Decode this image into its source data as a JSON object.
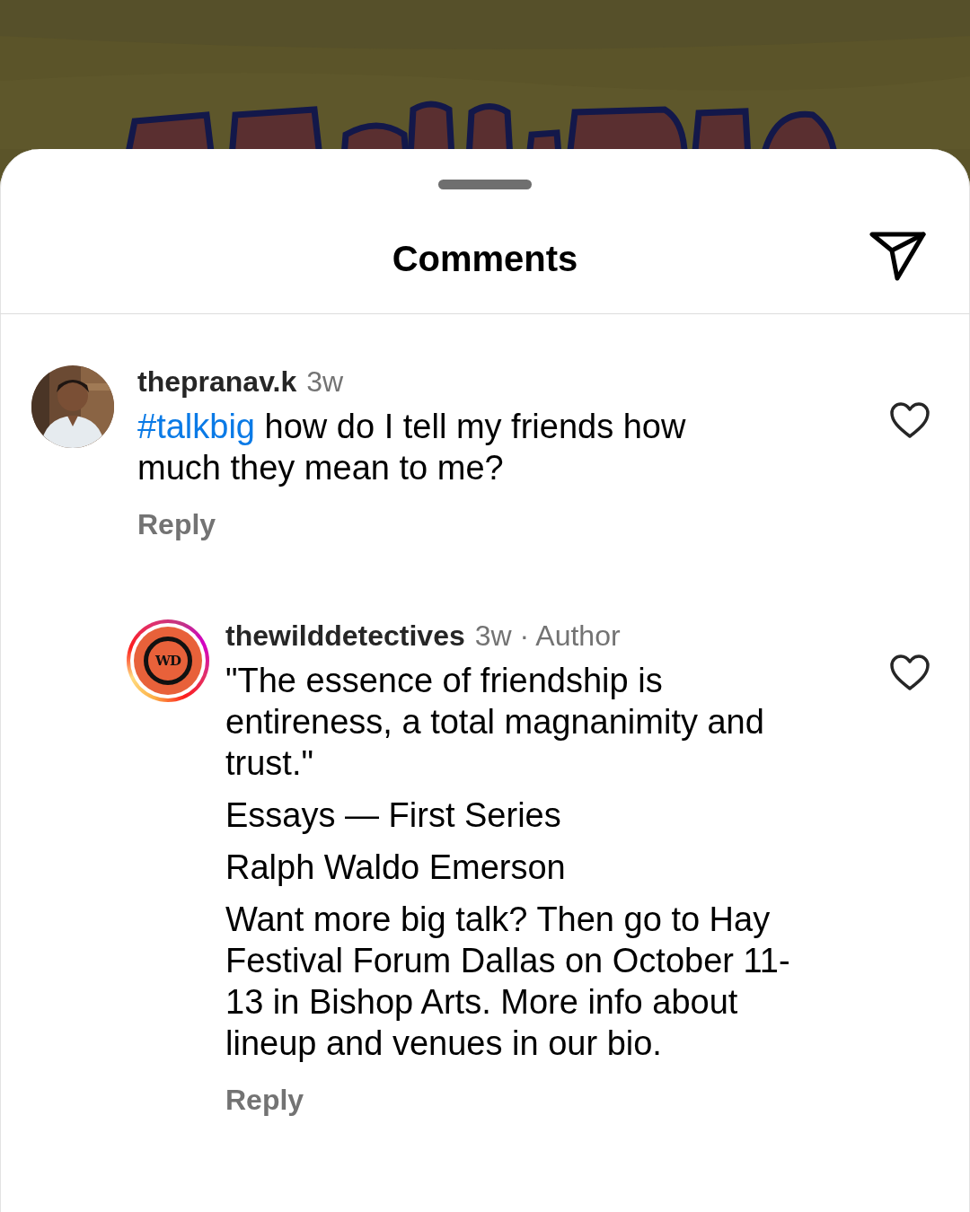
{
  "header": {
    "title": "Comments"
  },
  "comments": [
    {
      "username": "thepranav.k",
      "time": "3w",
      "hashtag": "#talkbig",
      "text": "how do I tell my friends how much they mean to me?",
      "liked": false,
      "reply_label": "Reply",
      "replies": [
        {
          "username": "thewilddetectives",
          "time": "3w · Author",
          "paragraphs": [
            "\"The essence of friendship is entireness, a total magnanimity and trust.\"",
            "Essays — First Series",
            "Ralph Waldo Emerson",
            "Want more big talk? Then go to Hay Festival Forum Dallas on October 11-13 in Bishop Arts. More info about lineup and venues in our bio."
          ],
          "liked": false,
          "reply_label": "Reply",
          "avatar": {
            "kind": "logo",
            "logo_text": "WD",
            "story_ring": true
          }
        }
      ]
    }
  ]
}
